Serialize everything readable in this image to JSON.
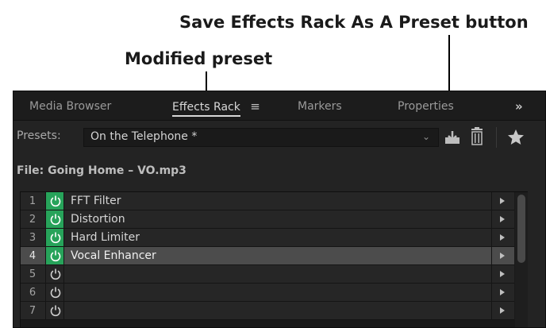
{
  "callouts": {
    "save_preset": "Save Effects Rack As A Preset button",
    "modified_preset": "Modified preset"
  },
  "tabs": [
    {
      "label": "Media Browser"
    },
    {
      "label": "Effects Rack",
      "active": true,
      "menu_icon": "hamburger-menu-icon"
    },
    {
      "label": "Markers"
    },
    {
      "label": "Properties"
    }
  ],
  "tab_overflow": "»",
  "presets": {
    "label": "Presets:",
    "value": "On the Telephone *",
    "chevron": "⌄"
  },
  "toolbar_icons": [
    "save-preset-icon",
    "trash-icon",
    "favorite-star-icon"
  ],
  "file": {
    "label": "File: Going Home – VO.mp3"
  },
  "effects": [
    {
      "num": "1",
      "name": "FFT Filter",
      "power": "on",
      "selected": false
    },
    {
      "num": "2",
      "name": "Distortion",
      "power": "on",
      "selected": false
    },
    {
      "num": "3",
      "name": "Hard Limiter",
      "power": "on",
      "selected": false
    },
    {
      "num": "4",
      "name": "Vocal Enhancer",
      "power": "on",
      "selected": true
    },
    {
      "num": "5",
      "name": "",
      "power": "off",
      "selected": false
    },
    {
      "num": "6",
      "name": "",
      "power": "off",
      "selected": false
    },
    {
      "num": "7",
      "name": "",
      "power": "off",
      "selected": false
    }
  ],
  "colors": {
    "power_on": "#27a35a",
    "panel_bg": "#232323",
    "selected_row": "#4c4c4c"
  }
}
